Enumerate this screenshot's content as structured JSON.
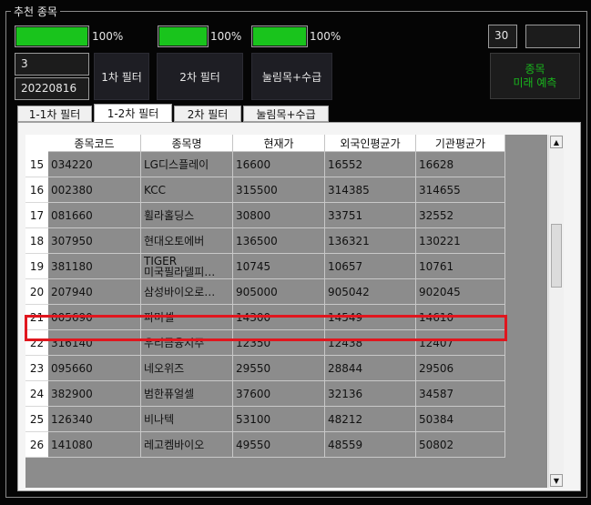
{
  "group": {
    "title": "추천 종목"
  },
  "progress": [
    {
      "label": "100%",
      "value": 100
    },
    {
      "label": "100%",
      "value": 100
    },
    {
      "label": "100%",
      "value": 100
    }
  ],
  "inputs": {
    "count_value": "3",
    "date_value": "20220816",
    "days_value": "30",
    "extra_value": ""
  },
  "buttons": {
    "filter1": "1차 필터",
    "filter2": "2차 필터",
    "pullback": "눌림목+수급",
    "predict_line1": "종목",
    "predict_line2": "미래 예측"
  },
  "tabs": [
    {
      "label": "1-1차 필터",
      "active": false
    },
    {
      "label": "1-2차 필터",
      "active": true
    },
    {
      "label": "2차 필터",
      "active": false
    },
    {
      "label": "눌림목+수급",
      "active": false
    }
  ],
  "table": {
    "columns": [
      "종목코드",
      "종목명",
      "현재가",
      "외국인평균가",
      "기관평균가"
    ],
    "rows": [
      {
        "num": "15",
        "code": "034220",
        "name": "LG디스플레이",
        "price": "16600",
        "foreign": "16552",
        "inst": "16628"
      },
      {
        "num": "16",
        "code": "002380",
        "name": "KCC",
        "price": "315500",
        "foreign": "314385",
        "inst": "314655"
      },
      {
        "num": "17",
        "code": "081660",
        "name": "휠라홀딩스",
        "price": "30800",
        "foreign": "33751",
        "inst": "32552"
      },
      {
        "num": "18",
        "code": "307950",
        "name": "현대오토에버",
        "price": "136500",
        "foreign": "136321",
        "inst": "130221"
      },
      {
        "num": "19",
        "code": "381180",
        "name": "TIGER\n미국필라델피…",
        "price": "10745",
        "foreign": "10657",
        "inst": "10761"
      },
      {
        "num": "20",
        "code": "207940",
        "name": "삼성바이오로…",
        "price": "905000",
        "foreign": "905042",
        "inst": "902045"
      },
      {
        "num": "21",
        "code": "005690",
        "name": "파미셀",
        "price": "14300",
        "foreign": "14549",
        "inst": "14610"
      },
      {
        "num": "22",
        "code": "316140",
        "name": "우리금융지주",
        "price": "12350",
        "foreign": "12438",
        "inst": "12407"
      },
      {
        "num": "23",
        "code": "095660",
        "name": "네오위즈",
        "price": "29550",
        "foreign": "28844",
        "inst": "29506"
      },
      {
        "num": "24",
        "code": "382900",
        "name": "범한퓨얼셀",
        "price": "37600",
        "foreign": "32136",
        "inst": "34587"
      },
      {
        "num": "25",
        "code": "126340",
        "name": "비나텍",
        "price": "53100",
        "foreign": "48212",
        "inst": "50384"
      },
      {
        "num": "26",
        "code": "141080",
        "name": "레고켐바이오",
        "price": "49550",
        "foreign": "48559",
        "inst": "50802"
      }
    ]
  },
  "scrollbar": {
    "up_icon": "▲",
    "down_icon": "▼"
  },
  "colors": {
    "progress": "#19c41c",
    "highlight": "#e0161e",
    "predict_text": "#19b51c"
  }
}
